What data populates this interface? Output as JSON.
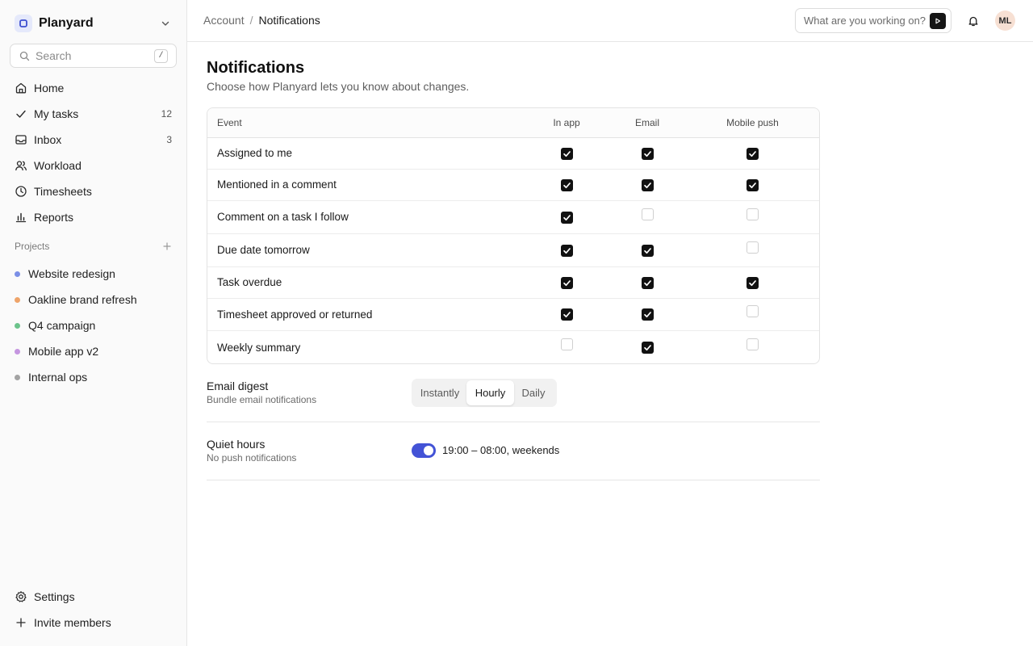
{
  "workspace": {
    "name": "Planyard"
  },
  "search": {
    "placeholder": "Search",
    "shortcut": "/"
  },
  "nav": {
    "items": [
      {
        "label": "Home",
        "icon": "home-icon"
      },
      {
        "label": "My tasks",
        "icon": "check-icon",
        "count": "12"
      },
      {
        "label": "Inbox",
        "icon": "inbox-icon",
        "count": "3"
      },
      {
        "label": "Workload",
        "icon": "users-icon"
      },
      {
        "label": "Timesheets",
        "icon": "clock-icon"
      },
      {
        "label": "Reports",
        "icon": "bar-chart-icon"
      }
    ]
  },
  "projects": {
    "title": "Projects",
    "items": [
      {
        "label": "Website redesign",
        "color": "#7b8fe6"
      },
      {
        "label": "Oakline brand refresh",
        "color": "#eea46a"
      },
      {
        "label": "Q4 campaign",
        "color": "#6cc38b"
      },
      {
        "label": "Mobile app v2",
        "color": "#c596e0"
      },
      {
        "label": "Internal ops",
        "color": "#a3a3a3"
      }
    ]
  },
  "sidebar_bottom": {
    "settings": "Settings",
    "invite": "Invite members"
  },
  "topbar": {
    "breadcrumb_parent": "Account",
    "breadcrumb_sep": "/",
    "breadcrumb_current": "Notifications",
    "ask_placeholder": "What are you working on?",
    "avatar_initials": "ML"
  },
  "page": {
    "title": "Notifications",
    "subtitle": "Choose how Planyard lets you know about changes."
  },
  "table": {
    "columns": [
      "Event",
      "In app",
      "Email",
      "Mobile push"
    ],
    "rows": [
      {
        "event": "Assigned to me",
        "in_app": true,
        "email": true,
        "push": true
      },
      {
        "event": "Mentioned in a comment",
        "in_app": true,
        "email": true,
        "push": true
      },
      {
        "event": "Comment on a task I follow",
        "in_app": true,
        "email": false,
        "push": false
      },
      {
        "event": "Due date tomorrow",
        "in_app": true,
        "email": true,
        "push": false
      },
      {
        "event": "Task overdue",
        "in_app": true,
        "email": true,
        "push": true
      },
      {
        "event": "Timesheet approved or returned",
        "in_app": true,
        "email": true,
        "push": false
      },
      {
        "event": "Weekly summary",
        "in_app": false,
        "email": true,
        "push": false
      }
    ]
  },
  "email_digest": {
    "title": "Email digest",
    "subtitle": "Bundle email notifications",
    "options": [
      "Instantly",
      "Hourly",
      "Daily"
    ],
    "selected": "Hourly"
  },
  "quiet_hours": {
    "title": "Quiet hours",
    "subtitle": "No push notifications",
    "enabled": true,
    "value": "19:00 – 08:00, weekends"
  },
  "colors": {
    "accent": "#4353d6",
    "checkbox_on": "#111111"
  }
}
